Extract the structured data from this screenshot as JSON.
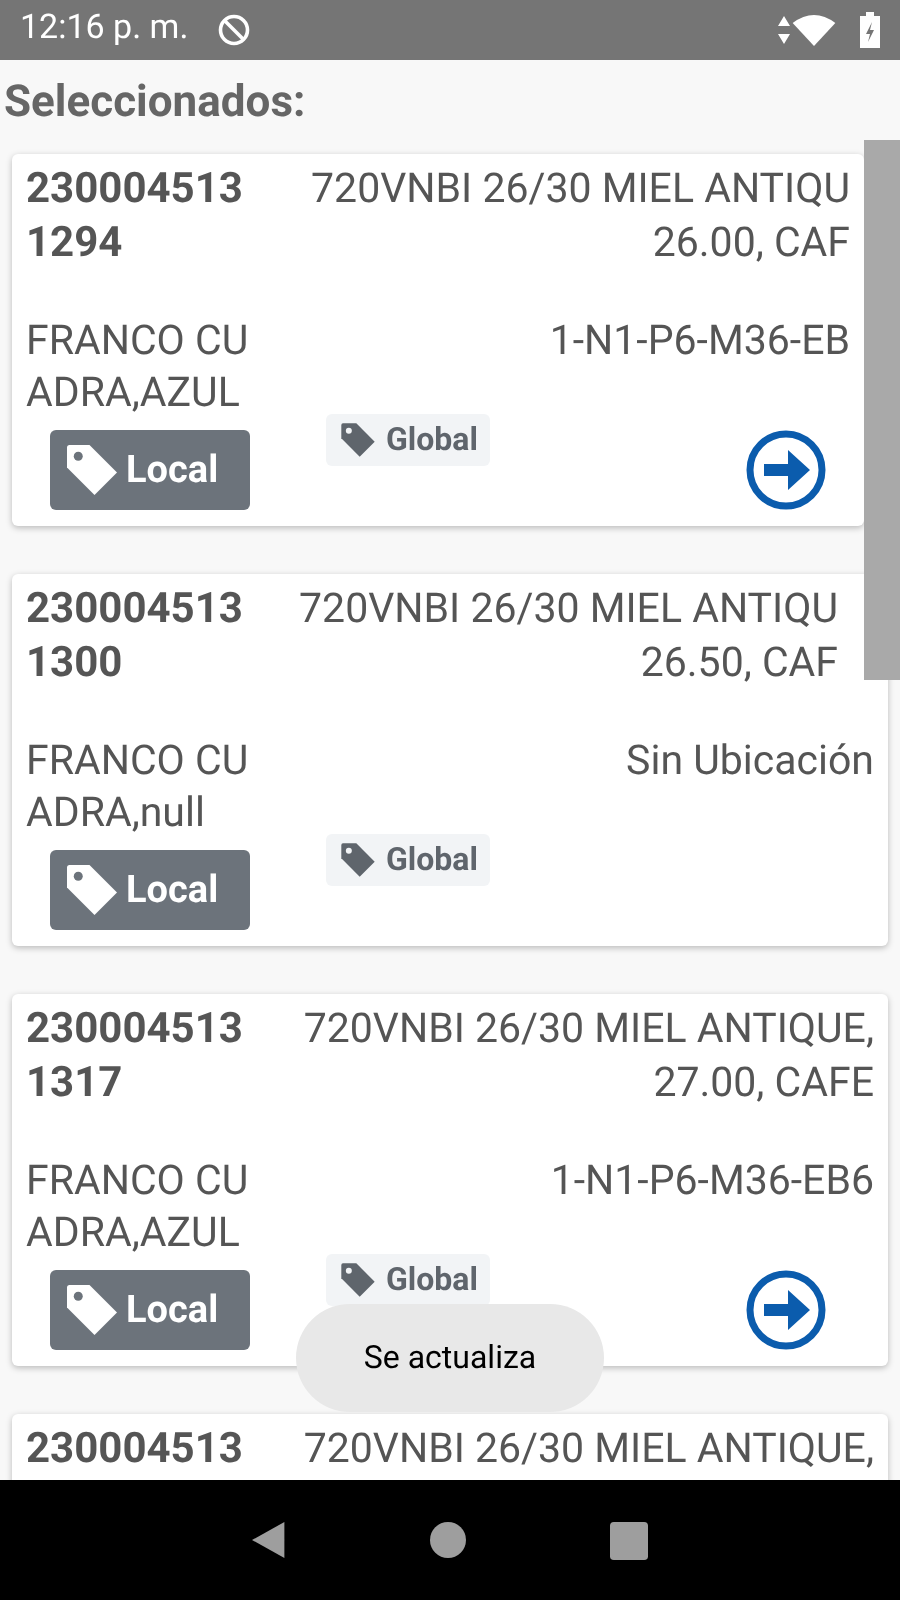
{
  "status_bar": {
    "time": "12:16 p. m."
  },
  "title": "Seleccionados:",
  "cards": [
    {
      "id_lines": [
        "230004513",
        "1294"
      ],
      "desc_lines": [
        "720VNBI 26/30 MIEL ANTIQU",
        "26.00, CAF"
      ],
      "name_lines": [
        "FRANCO CU",
        "ADRA,AZUL"
      ],
      "location": "1-N1-P6-M36-EB",
      "local_label": "Local",
      "global_label": "Global",
      "has_action": true
    },
    {
      "id_lines": [
        "230004513",
        "1300"
      ],
      "desc_lines": [
        "720VNBI 26/30 MIEL ANTIQU",
        "26.50, CAF"
      ],
      "name_lines": [
        "FRANCO CU",
        "ADRA,null"
      ],
      "location": "Sin Ubicación",
      "local_label": "Local",
      "global_label": "Global",
      "has_action": false
    },
    {
      "id_lines": [
        "230004513",
        "1317"
      ],
      "desc_lines": [
        "720VNBI 26/30 MIEL ANTIQUE,",
        "27.00, CAFE"
      ],
      "name_lines": [
        "FRANCO CU",
        "ADRA,AZUL"
      ],
      "location": "1-N1-P6-M36-EB6",
      "local_label": "Local",
      "global_label": "Global",
      "has_action": true
    },
    {
      "id_lines": [
        "230004513"
      ],
      "desc_lines": [
        "720VNBI 26/30 MIEL ANTIQUE,"
      ]
    }
  ],
  "toast": "Se actualiza"
}
